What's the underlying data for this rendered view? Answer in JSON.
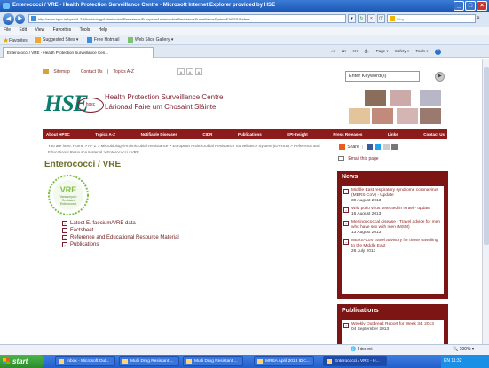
{
  "browser": {
    "title": "Enterococci / VRE - Health Protection Surveillance Centre - Microsoft Internet Explorer provided by HSE",
    "url": "http://www.hpsc.ie/hpsc/A-Z/MicrobiologyAntimicrobialResistance/EuropeanAntimicrobialResistanceSurveillanceSystemEARSS/Refere",
    "search_placeholder": "Bing",
    "menu": [
      "File",
      "Edit",
      "View",
      "Favorites",
      "Tools",
      "Help"
    ],
    "favorites_label": "Favorites",
    "favorites_items": [
      "Suggested Sites ▾",
      "Free Hotmail",
      "Web Slice Gallery ▾"
    ],
    "tab": "Enterococci / VRE - Health Protection Surveillance Cen...",
    "commands": [
      "Page ▾",
      "Safety ▾",
      "Tools ▾"
    ],
    "status_zone": "Internet",
    "zoom": "100%"
  },
  "site": {
    "top_links": [
      "Sitemap",
      "|",
      "Contact Us",
      "|",
      "Topics A-Z"
    ],
    "text_size": [
      "A",
      "A",
      "A"
    ],
    "keyword_placeholder": "Enter Keyword(s)",
    "logo_text": "HSE",
    "logo_ring": "hpsc",
    "org_name": "Health Protection Surveillance Centre",
    "org_name_irish": "Lárionad Faire um Chosaint Sláinte",
    "nav": [
      "About HPSC",
      "Topics A-Z",
      "Notifiable Diseases",
      "CIDR",
      "Publications",
      "EPI-Insight",
      "Press Releases",
      "Links",
      "Contact Us"
    ],
    "breadcrumb": "You are here: Home > A - Z > Microbiology/Antimicrobial Resistance > European Antimicrobial Resistance Surveillance System (EARSS) > Reference and Educational Resource Material > Enterococci / VRE",
    "share_label": "Share",
    "email_label": "Email this page",
    "page_title": "Enterococci / VRE",
    "vre_logo": {
      "big": "VRE",
      "l1": "Vancomycin",
      "l2": "Resistant",
      "l3": "Enterococci"
    },
    "links": [
      "Latest E. faecium/VRE data",
      "Factsheet",
      "Reference and Educational Resource Material",
      "Publications"
    ]
  },
  "news": {
    "title": "News",
    "items": [
      {
        "text": "Middle East respiratory syndrome coronavirus (MERS-CoV) - Update",
        "date": "30 August 2013"
      },
      {
        "text": "Wild polio virus detected in Israel - update",
        "date": "16 August 2013"
      },
      {
        "text": "Meningococcal disease - Travel advice for men who have sex with men (MSM)",
        "date": "13 August 2013"
      },
      {
        "text": "MERS-CoV travel advisory for those travelling to the Middle East",
        "date": "26 July 2013"
      }
    ]
  },
  "publications": {
    "title": "Publications",
    "items": [
      {
        "text": "Weekly Outbreak Report for Week 34, 2013",
        "date": "04 September 2013"
      }
    ]
  },
  "taskbar": {
    "start": "start",
    "tasks": [
      "Inbox - Microsoft Out...",
      "Multi Drug Resistant ...",
      "Multi Drug Resistant ...",
      "MRSA April 2013 IDC...",
      "Enterococci / VRE - H..."
    ],
    "tray": "EN  11:32"
  }
}
